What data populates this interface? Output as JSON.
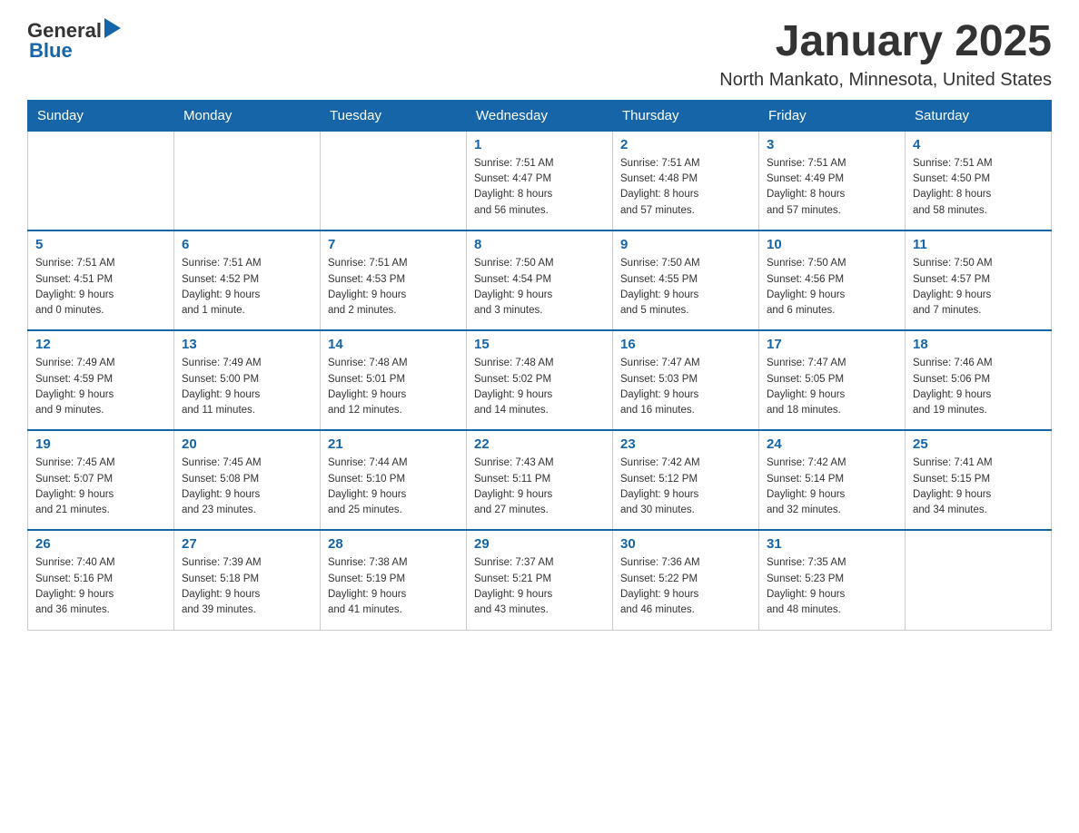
{
  "logo": {
    "text_general": "General",
    "text_blue": "Blue"
  },
  "title": "January 2025",
  "subtitle": "North Mankato, Minnesota, United States",
  "weekdays": [
    "Sunday",
    "Monday",
    "Tuesday",
    "Wednesday",
    "Thursday",
    "Friday",
    "Saturday"
  ],
  "weeks": [
    [
      {
        "day": "",
        "info": ""
      },
      {
        "day": "",
        "info": ""
      },
      {
        "day": "",
        "info": ""
      },
      {
        "day": "1",
        "info": "Sunrise: 7:51 AM\nSunset: 4:47 PM\nDaylight: 8 hours\nand 56 minutes."
      },
      {
        "day": "2",
        "info": "Sunrise: 7:51 AM\nSunset: 4:48 PM\nDaylight: 8 hours\nand 57 minutes."
      },
      {
        "day": "3",
        "info": "Sunrise: 7:51 AM\nSunset: 4:49 PM\nDaylight: 8 hours\nand 57 minutes."
      },
      {
        "day": "4",
        "info": "Sunrise: 7:51 AM\nSunset: 4:50 PM\nDaylight: 8 hours\nand 58 minutes."
      }
    ],
    [
      {
        "day": "5",
        "info": "Sunrise: 7:51 AM\nSunset: 4:51 PM\nDaylight: 9 hours\nand 0 minutes."
      },
      {
        "day": "6",
        "info": "Sunrise: 7:51 AM\nSunset: 4:52 PM\nDaylight: 9 hours\nand 1 minute."
      },
      {
        "day": "7",
        "info": "Sunrise: 7:51 AM\nSunset: 4:53 PM\nDaylight: 9 hours\nand 2 minutes."
      },
      {
        "day": "8",
        "info": "Sunrise: 7:50 AM\nSunset: 4:54 PM\nDaylight: 9 hours\nand 3 minutes."
      },
      {
        "day": "9",
        "info": "Sunrise: 7:50 AM\nSunset: 4:55 PM\nDaylight: 9 hours\nand 5 minutes."
      },
      {
        "day": "10",
        "info": "Sunrise: 7:50 AM\nSunset: 4:56 PM\nDaylight: 9 hours\nand 6 minutes."
      },
      {
        "day": "11",
        "info": "Sunrise: 7:50 AM\nSunset: 4:57 PM\nDaylight: 9 hours\nand 7 minutes."
      }
    ],
    [
      {
        "day": "12",
        "info": "Sunrise: 7:49 AM\nSunset: 4:59 PM\nDaylight: 9 hours\nand 9 minutes."
      },
      {
        "day": "13",
        "info": "Sunrise: 7:49 AM\nSunset: 5:00 PM\nDaylight: 9 hours\nand 11 minutes."
      },
      {
        "day": "14",
        "info": "Sunrise: 7:48 AM\nSunset: 5:01 PM\nDaylight: 9 hours\nand 12 minutes."
      },
      {
        "day": "15",
        "info": "Sunrise: 7:48 AM\nSunset: 5:02 PM\nDaylight: 9 hours\nand 14 minutes."
      },
      {
        "day": "16",
        "info": "Sunrise: 7:47 AM\nSunset: 5:03 PM\nDaylight: 9 hours\nand 16 minutes."
      },
      {
        "day": "17",
        "info": "Sunrise: 7:47 AM\nSunset: 5:05 PM\nDaylight: 9 hours\nand 18 minutes."
      },
      {
        "day": "18",
        "info": "Sunrise: 7:46 AM\nSunset: 5:06 PM\nDaylight: 9 hours\nand 19 minutes."
      }
    ],
    [
      {
        "day": "19",
        "info": "Sunrise: 7:45 AM\nSunset: 5:07 PM\nDaylight: 9 hours\nand 21 minutes."
      },
      {
        "day": "20",
        "info": "Sunrise: 7:45 AM\nSunset: 5:08 PM\nDaylight: 9 hours\nand 23 minutes."
      },
      {
        "day": "21",
        "info": "Sunrise: 7:44 AM\nSunset: 5:10 PM\nDaylight: 9 hours\nand 25 minutes."
      },
      {
        "day": "22",
        "info": "Sunrise: 7:43 AM\nSunset: 5:11 PM\nDaylight: 9 hours\nand 27 minutes."
      },
      {
        "day": "23",
        "info": "Sunrise: 7:42 AM\nSunset: 5:12 PM\nDaylight: 9 hours\nand 30 minutes."
      },
      {
        "day": "24",
        "info": "Sunrise: 7:42 AM\nSunset: 5:14 PM\nDaylight: 9 hours\nand 32 minutes."
      },
      {
        "day": "25",
        "info": "Sunrise: 7:41 AM\nSunset: 5:15 PM\nDaylight: 9 hours\nand 34 minutes."
      }
    ],
    [
      {
        "day": "26",
        "info": "Sunrise: 7:40 AM\nSunset: 5:16 PM\nDaylight: 9 hours\nand 36 minutes."
      },
      {
        "day": "27",
        "info": "Sunrise: 7:39 AM\nSunset: 5:18 PM\nDaylight: 9 hours\nand 39 minutes."
      },
      {
        "day": "28",
        "info": "Sunrise: 7:38 AM\nSunset: 5:19 PM\nDaylight: 9 hours\nand 41 minutes."
      },
      {
        "day": "29",
        "info": "Sunrise: 7:37 AM\nSunset: 5:21 PM\nDaylight: 9 hours\nand 43 minutes."
      },
      {
        "day": "30",
        "info": "Sunrise: 7:36 AM\nSunset: 5:22 PM\nDaylight: 9 hours\nand 46 minutes."
      },
      {
        "day": "31",
        "info": "Sunrise: 7:35 AM\nSunset: 5:23 PM\nDaylight: 9 hours\nand 48 minutes."
      },
      {
        "day": "",
        "info": ""
      }
    ]
  ]
}
